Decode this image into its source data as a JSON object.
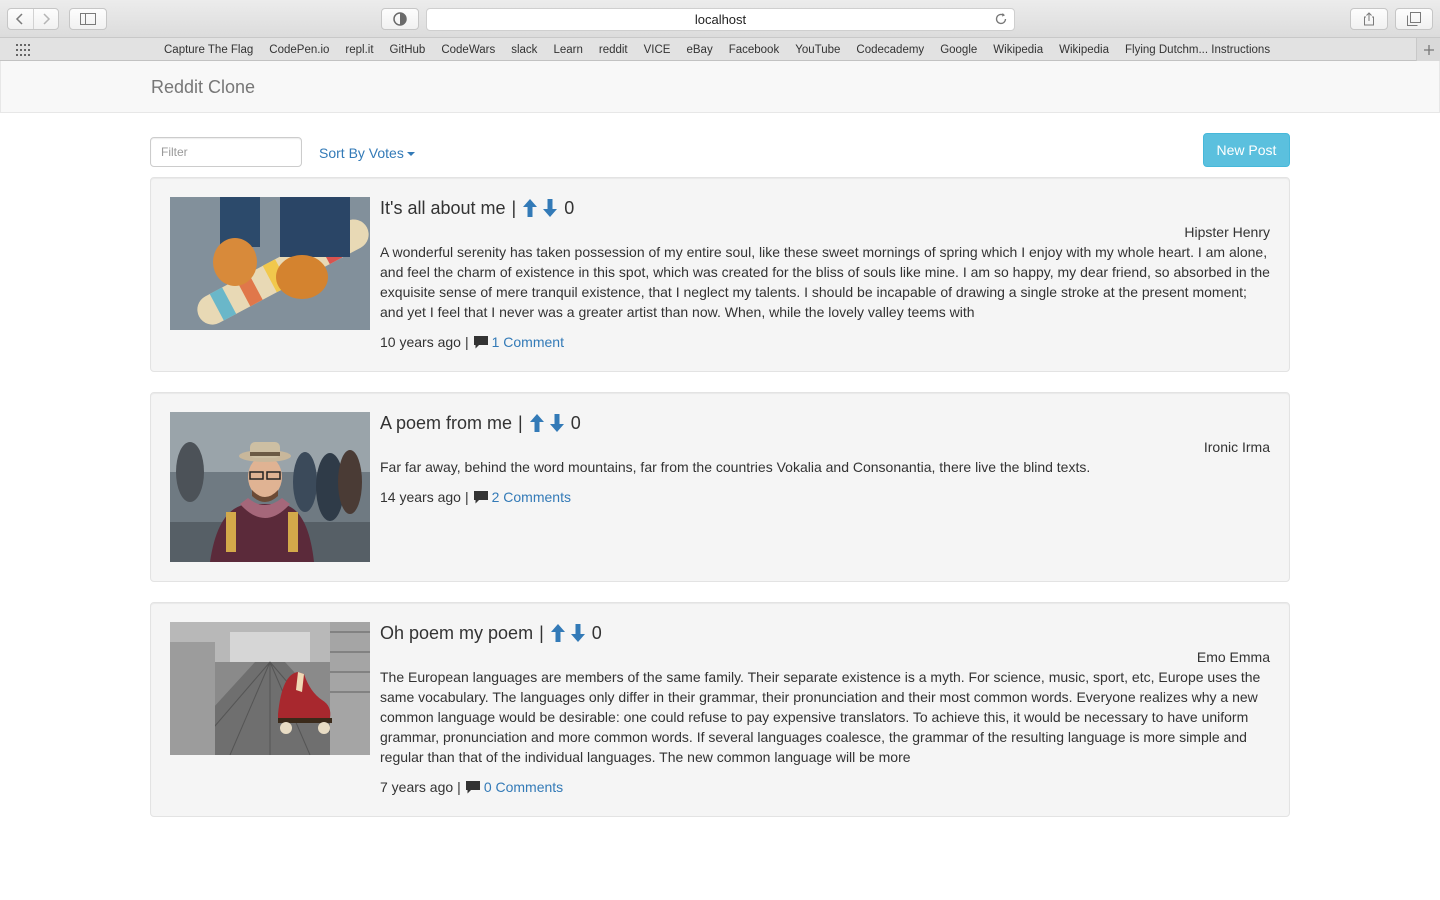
{
  "browser": {
    "url": "localhost",
    "bookmarks": [
      "Capture The Flag",
      "CodePen.io",
      "repl.it",
      "GitHub",
      "CodeWars",
      "slack",
      "Learn",
      "reddit",
      "VICE",
      "eBay",
      "Facebook",
      "YouTube",
      "Codecademy",
      "Google",
      "Wikipedia",
      "Wikipedia",
      "Flying Dutchm... Instructions"
    ]
  },
  "navbar": {
    "brand": "Reddit Clone"
  },
  "toolbar": {
    "filter_placeholder": "Filter",
    "sort_label": "Sort By Votes",
    "new_post_label": "New Post"
  },
  "colors": {
    "link": "#337ab7",
    "info_button": "#5bc0de",
    "well": "#f5f5f5"
  },
  "posts": [
    {
      "title": "It's all about me",
      "separator": "|",
      "score": "0",
      "author": "Hipster Henry",
      "body": "A wonderful serenity has taken possession of my entire soul, like these sweet mornings of spring which I enjoy with my whole heart. I am alone, and feel the charm of existence in this spot, which was created for the bliss of souls like mine. I am so happy, my dear friend, so absorbed in the exquisite sense of mere tranquil existence, that I neglect my talents. I should be incapable of drawing a single stroke at the present moment; and yet I feel that I never was a greater artist than now. When, while the lovely valley teems with",
      "time": "10 years ago",
      "comments": "1 Comment",
      "image": "skateboard-shoes-photo"
    },
    {
      "title": "A poem from me",
      "separator": "|",
      "score": "0",
      "author": "Ironic Irma",
      "body": "Far far away, behind the word mountains, far from the countries Vokalia and Consonantia, there live the blind texts.",
      "time": "14 years ago",
      "comments": "2 Comments",
      "image": "hipster-man-photo"
    },
    {
      "title": "Oh poem my poem",
      "separator": "|",
      "score": "0",
      "author": "Emo Emma",
      "body": "The European languages are members of the same family. Their separate existence is a myth. For science, music, sport, etc, Europe uses the same vocabulary. The languages only differ in their grammar, their pronunciation and their most common words. Everyone realizes why a new common language would be desirable: one could refuse to pay expensive translators. To achieve this, it would be necessary to have uniform grammar, pronunciation and more common words. If several languages coalesce, the grammar of the resulting language is more simple and regular than that of the individual languages. The new common language will be more",
      "time": "7 years ago",
      "comments": "0 Comments",
      "image": "roller-skates-photo"
    }
  ]
}
